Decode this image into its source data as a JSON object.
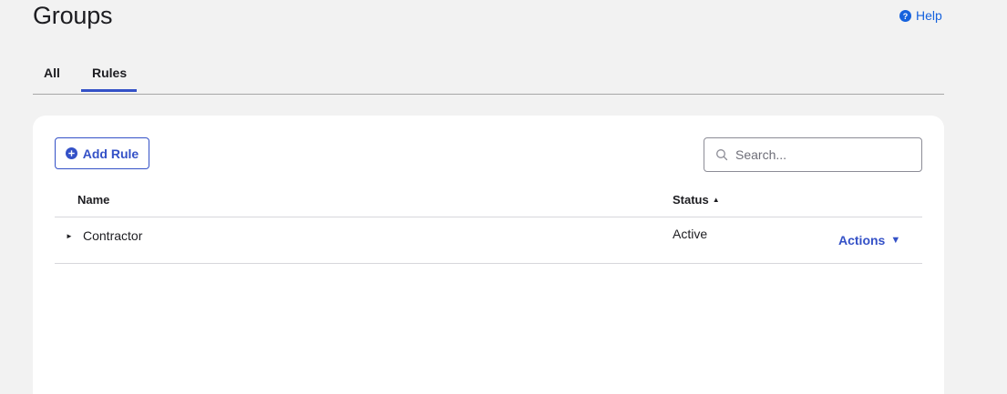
{
  "header": {
    "title": "Groups",
    "help_label": "Help"
  },
  "tabs": [
    {
      "label": "All",
      "active": false
    },
    {
      "label": "Rules",
      "active": true
    }
  ],
  "toolbar": {
    "add_rule_label": "Add Rule",
    "search_placeholder": "Search...",
    "search_value": ""
  },
  "table": {
    "columns": {
      "name": "Name",
      "status": "Status"
    },
    "sort": {
      "column": "Status",
      "direction": "ascending"
    },
    "rows": [
      {
        "name": "Contractor",
        "status": "Active",
        "actions_label": "Actions"
      }
    ]
  },
  "colors": {
    "accent": "#3451c7",
    "link": "#1662dd",
    "background": "#f2f2f2",
    "card": "#ffffff"
  },
  "icons": {
    "help": "question-circle-icon",
    "add": "plus-circle-icon",
    "search": "search-icon",
    "sort": "sort-ascending-icon",
    "expand": "expand-triangle-icon",
    "actions": "caret-down-icon"
  }
}
